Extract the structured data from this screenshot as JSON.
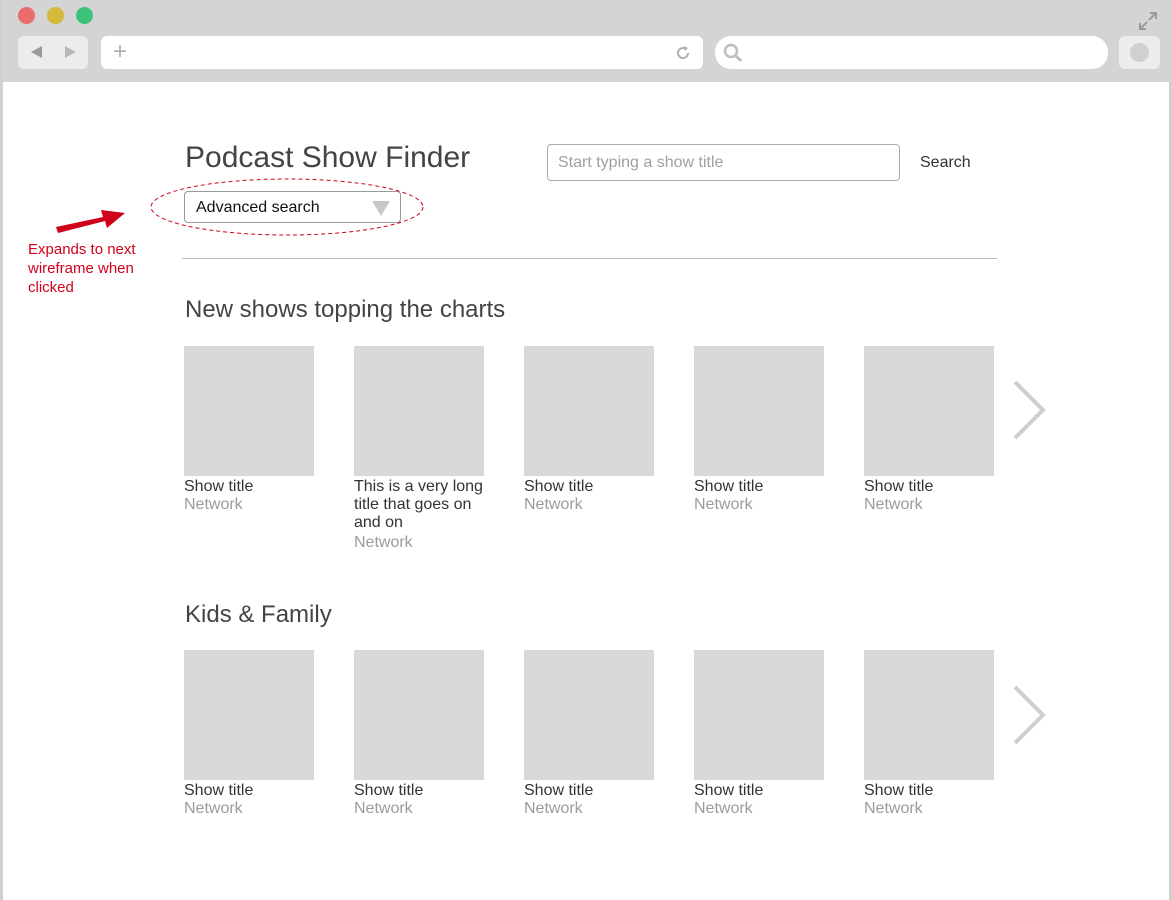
{
  "browser": {
    "address_plus": "+"
  },
  "header": {
    "title": "Podcast Show Finder",
    "search_placeholder": "Start typing a show title",
    "search_label": "Search",
    "advanced_search_label": "Advanced search"
  },
  "annotation": {
    "note": "Expands to next wireframe when clicked",
    "color": "#d0021b"
  },
  "sections": [
    {
      "title": "New shows topping the charts",
      "shows": [
        {
          "title": "Show title",
          "network": "Network"
        },
        {
          "title": "This is a very long title that goes on and on",
          "network": "Network"
        },
        {
          "title": "Show title",
          "network": "Network"
        },
        {
          "title": "Show title",
          "network": "Network"
        },
        {
          "title": "Show title",
          "network": "Network"
        }
      ]
    },
    {
      "title": "Kids & Family",
      "shows": [
        {
          "title": "Show title",
          "network": "Network"
        },
        {
          "title": "Show title",
          "network": "Network"
        },
        {
          "title": "Show title",
          "network": "Network"
        },
        {
          "title": "Show title",
          "network": "Network"
        },
        {
          "title": "Show title",
          "network": "Network"
        }
      ]
    }
  ],
  "icons": {
    "next": "chevron-right-icon",
    "search": "magnifier-icon",
    "reload": "reload-icon",
    "expand": "expand-icon"
  }
}
